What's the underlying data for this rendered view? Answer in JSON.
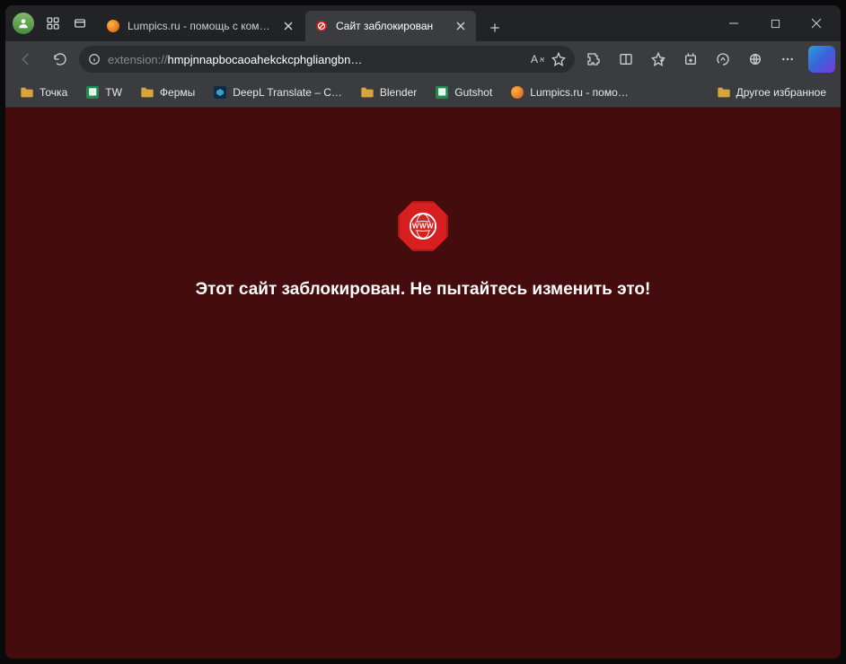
{
  "tabs": [
    {
      "label": "Lumpics.ru - помощь с компьют",
      "active": false,
      "favicon": "lumpics"
    },
    {
      "label": "Сайт заблокирован",
      "active": true,
      "favicon": "block"
    }
  ],
  "address": {
    "scheme": "extension://",
    "host": "hmpjnnapbocaoahekckcphgliangbn…"
  },
  "bookmarks": [
    {
      "label": "Точка",
      "icon": "folder"
    },
    {
      "label": "TW",
      "icon": "sheet"
    },
    {
      "label": "Фермы",
      "icon": "folder"
    },
    {
      "label": "DeepL Translate – С…",
      "icon": "deepl"
    },
    {
      "label": "Blender",
      "icon": "folder"
    },
    {
      "label": "Gutshot",
      "icon": "sheet"
    },
    {
      "label": "Lumpics.ru - помо…",
      "icon": "lumpics"
    }
  ],
  "other_bookmarks_label": "Другое избранное",
  "page": {
    "www_label": "WWW",
    "message": "Этот сайт заблокирован. Не пытайтесь изменить это!"
  }
}
